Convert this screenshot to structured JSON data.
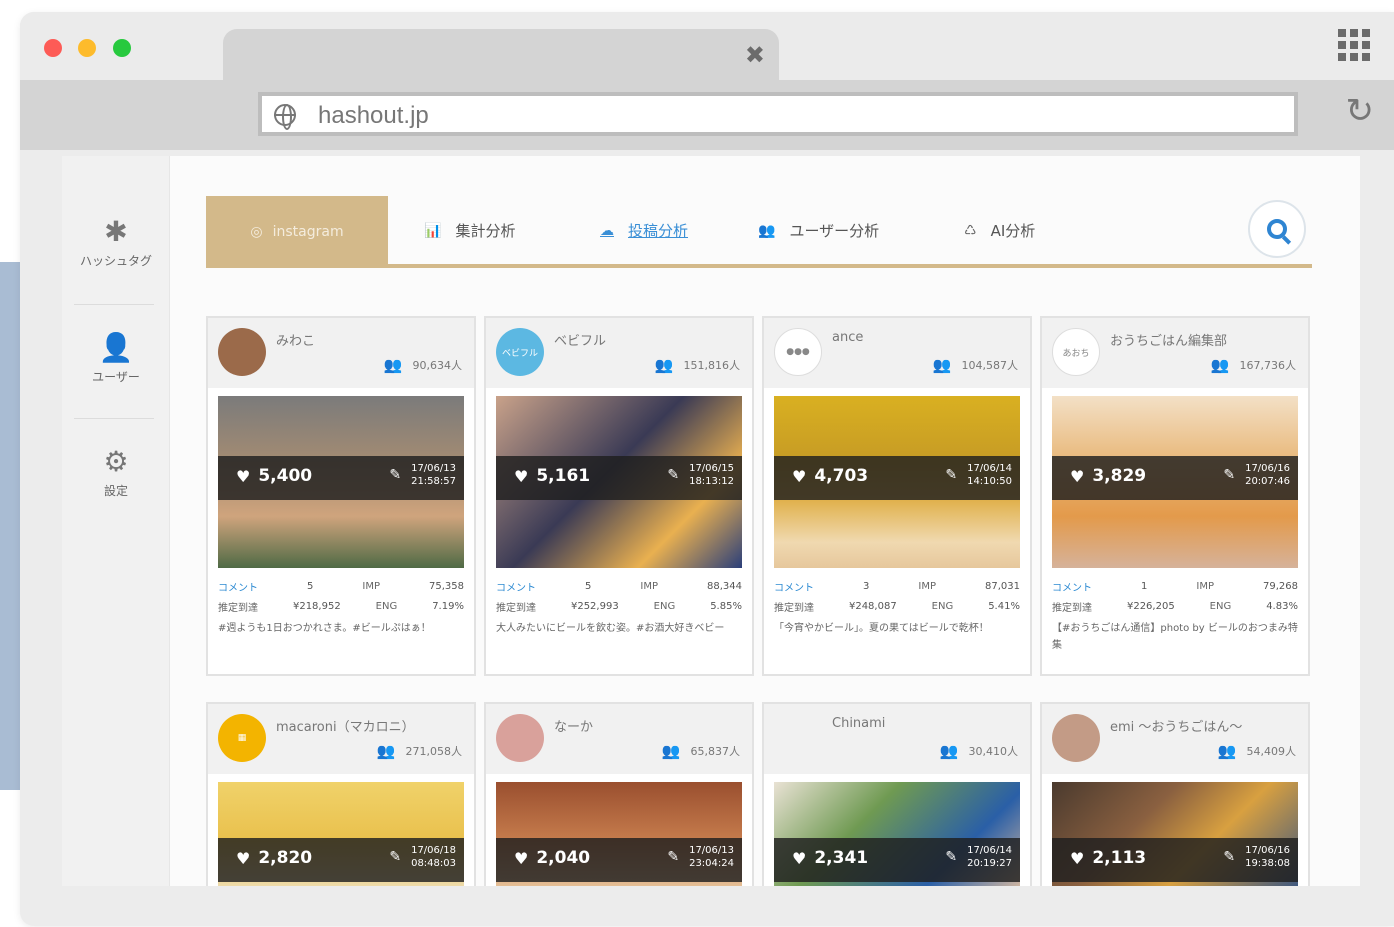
{
  "browser": {
    "url": "hashout.jp",
    "tab_close": "✖",
    "reload": "↻"
  },
  "sidebar": {
    "items": [
      {
        "icon": "✱",
        "label": "ハッシュタグ"
      },
      {
        "icon": "👤",
        "label": "ユーザー"
      },
      {
        "icon": "⚙",
        "label": "設定"
      }
    ]
  },
  "nav": {
    "instagram_label": "instagram",
    "items": [
      {
        "icon": "📊",
        "label": "集計分析"
      },
      {
        "icon": "☁",
        "label": "投稿分析"
      },
      {
        "icon": "👥",
        "label": "ユーザー分析"
      },
      {
        "icon": "♺",
        "label": "AI分析"
      }
    ]
  },
  "posts": [
    {
      "name": "みわこ",
      "followers": "90,634人",
      "likes": "5,400",
      "date": "17/06/13",
      "time": "21:58:57",
      "comment_label": "コメント",
      "comments": "5",
      "imp_label": "IMP",
      "imp": "75,358",
      "reach_label": "推定到達",
      "reach": "¥218,952",
      "eng_label": "ENG",
      "eng": "7.19%",
      "caption": "#週ようも1日おつかれさま。#ビールぷはぁ！"
    },
    {
      "name": "ベビフル",
      "followers": "151,816人",
      "likes": "5,161",
      "date": "17/06/15",
      "time": "18:13:12",
      "comment_label": "コメント",
      "comments": "5",
      "imp_label": "IMP",
      "imp": "88,344",
      "reach_label": "推定到達",
      "reach": "¥252,993",
      "eng_label": "ENG",
      "eng": "5.85%",
      "caption": "大人みたいにビールを飲む姿。#お酒大好きベビー"
    },
    {
      "name": "ance",
      "followers": "104,587人",
      "likes": "4,703",
      "date": "17/06/14",
      "time": "14:10:50",
      "comment_label": "コメント",
      "comments": "3",
      "imp_label": "IMP",
      "imp": "87,031",
      "reach_label": "推定到達",
      "reach": "¥248,087",
      "eng_label": "ENG",
      "eng": "5.41%",
      "caption": "「今宵やかビール」。夏の果てはビールで乾杯！"
    },
    {
      "name": "おうちごはん編集部",
      "followers": "167,736人",
      "likes": "3,829",
      "date": "17/06/16",
      "time": "20:07:46",
      "comment_label": "コメント",
      "comments": "1",
      "imp_label": "IMP",
      "imp": "79,268",
      "reach_label": "推定到達",
      "reach": "¥226,205",
      "eng_label": "ENG",
      "eng": "4.83%",
      "caption": "【#おうちごはん通信】photo by ビールのおつまみ特集"
    },
    {
      "name": "macaroni（マカロニ）",
      "followers": "271,058人",
      "likes": "2,820",
      "date": "17/06/18",
      "time": "08:48:03"
    },
    {
      "name": "なーか",
      "followers": "65,837人",
      "likes": "2,040",
      "date": "17/06/13",
      "time": "23:04:24"
    },
    {
      "name": "Chinami",
      "followers": "30,410人",
      "likes": "2,341",
      "date": "17/06/14",
      "time": "20:19:27"
    },
    {
      "name": "emi 〜おうちごはん〜",
      "followers": "54,409人",
      "likes": "2,113",
      "date": "17/06/16",
      "time": "19:38:08"
    }
  ],
  "colors": {
    "accent_gold": "#d3b98a",
    "link_blue": "#2f85d2",
    "side_blue": "#a9bcd3"
  }
}
